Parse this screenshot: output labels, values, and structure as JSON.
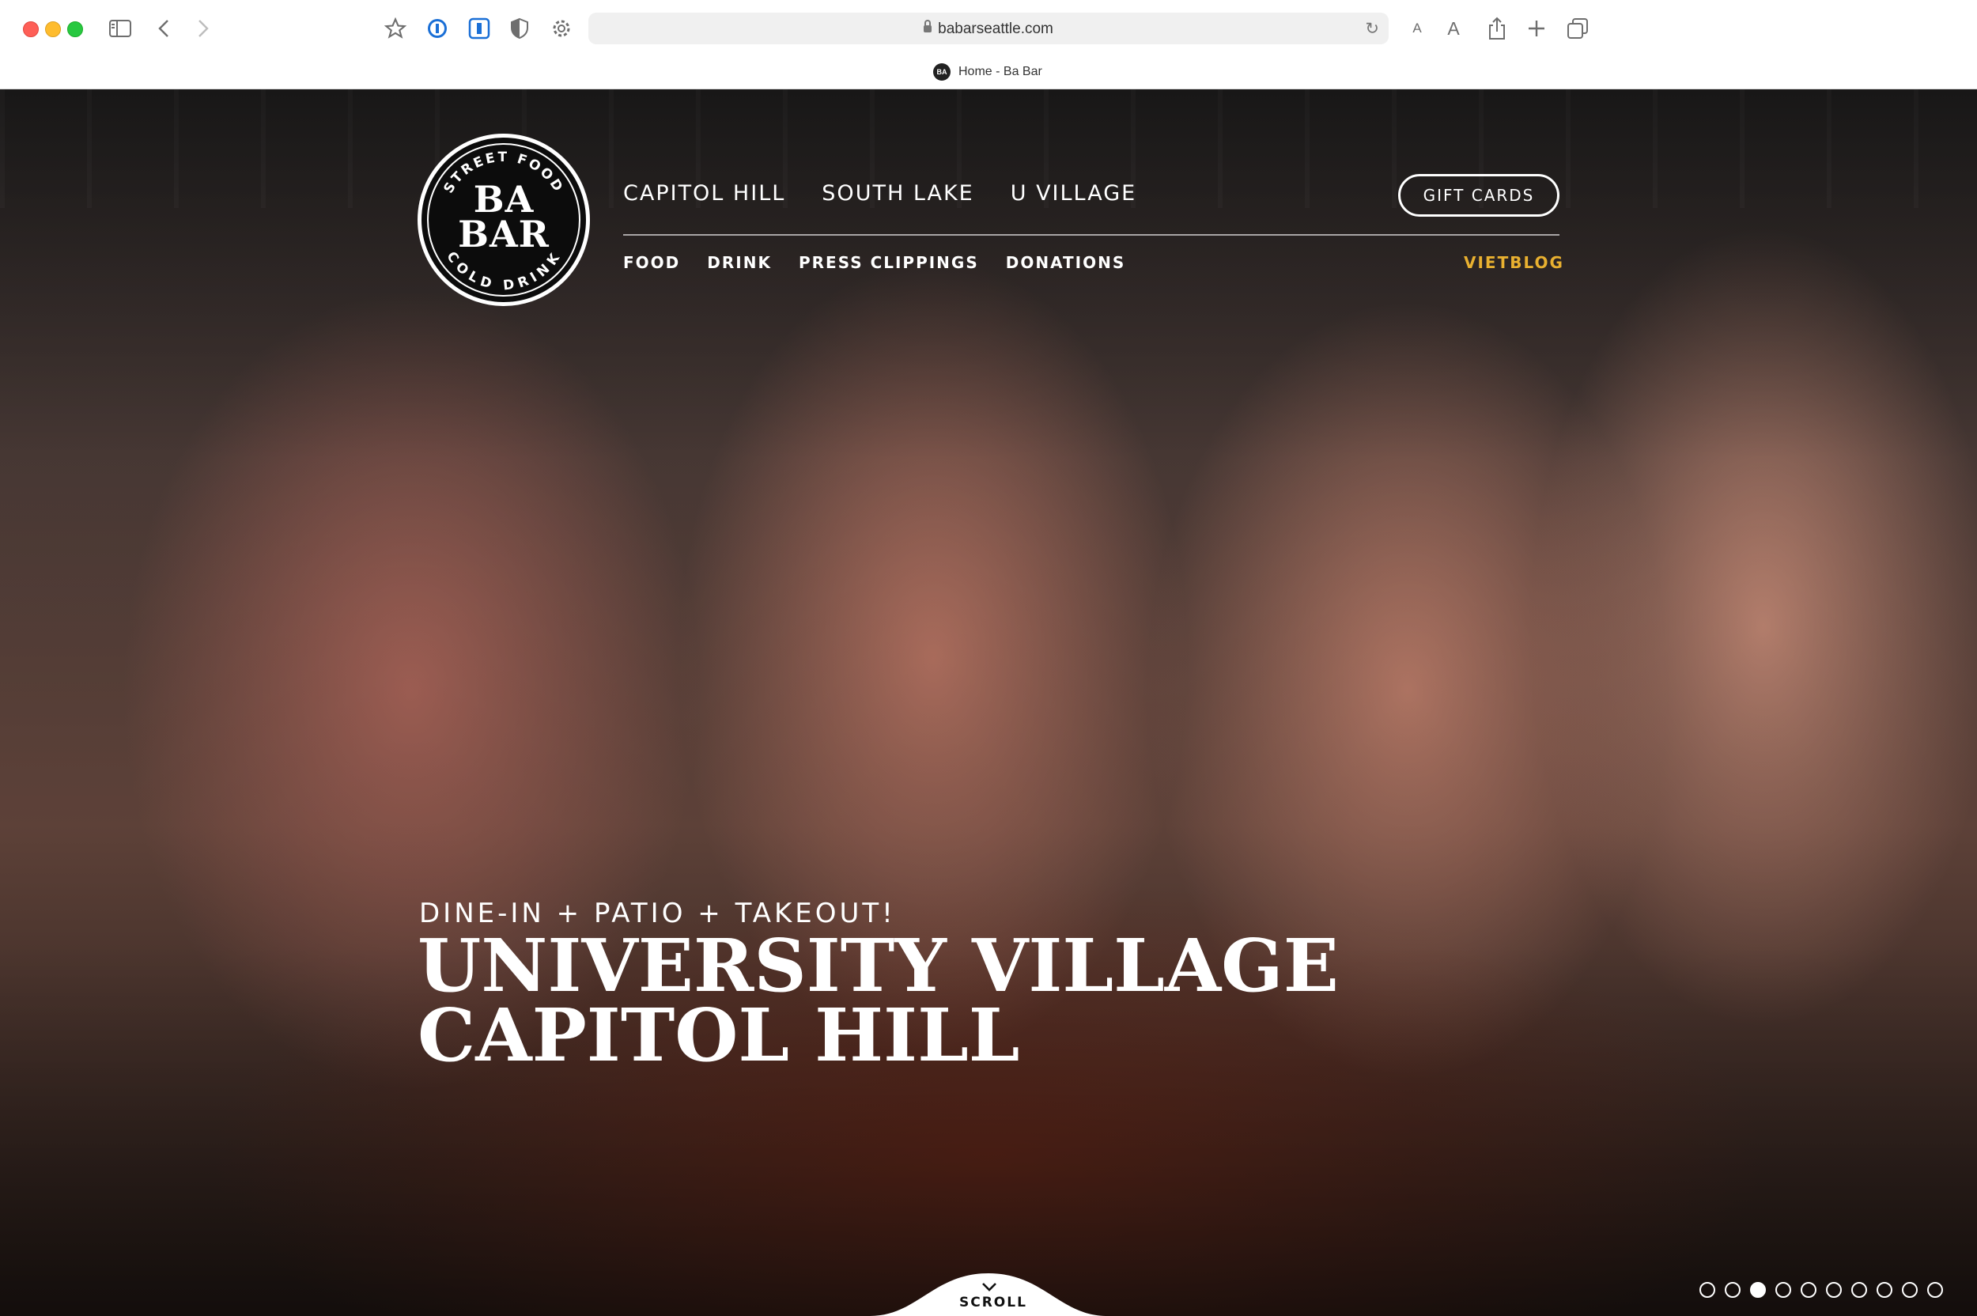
{
  "browser": {
    "url": "babarseattle.com",
    "tab_title": "Home - Ba Bar",
    "favicon_text": "BA",
    "icons": [
      "sidebar-icon",
      "back-icon",
      "forward-icon",
      "bookmark-star-icon",
      "onepassword-icon",
      "instapaper-icon",
      "shield-icon",
      "gear-icon",
      "reload-icon",
      "text-smaller-icon",
      "text-larger-icon",
      "share-icon",
      "new-tab-icon",
      "tab-overview-icon"
    ],
    "text_small": "A",
    "text_large": "A"
  },
  "site": {
    "logo": {
      "top_arc": "STREET FOOD",
      "line1": "BA",
      "line2": "BAR",
      "bottom_arc": "COLD DRINK"
    },
    "nav_primary": [
      "CAPITOL HILL",
      "SOUTH LAKE",
      "U VILLAGE"
    ],
    "nav_secondary": [
      "FOOD",
      "DRINK",
      "PRESS CLIPPINGS",
      "DONATIONS"
    ],
    "gift_cards": "GIFT CARDS",
    "vietblog": "VIETBLOG",
    "accent_color": "#e8b030",
    "hero": {
      "subhead": "DINE-IN + PATIO + TAKEOUT!",
      "headline_line1": "UNIVERSITY VILLAGE",
      "headline_line2": "CAPITOL HILL"
    },
    "scroll_label": "SCROLL",
    "slider": {
      "count": 10,
      "active_index": 2
    }
  }
}
